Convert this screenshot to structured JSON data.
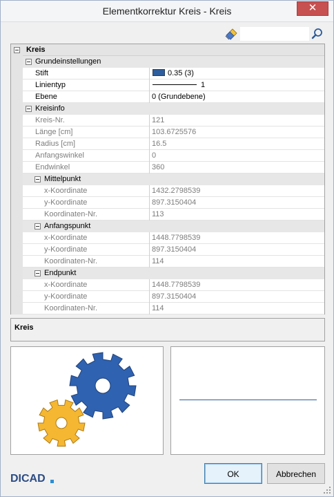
{
  "window": {
    "title": "Elementkorrektur Kreis - Kreis",
    "close_glyph": "✕"
  },
  "search": {
    "value": "",
    "placeholder": ""
  },
  "grid": {
    "rows": [
      {
        "kind": "section",
        "label": "Kreis"
      },
      {
        "kind": "cat",
        "label": "Grundeinstellungen"
      },
      {
        "kind": "prop",
        "label": "Stift",
        "value": "0.35 (3)",
        "swatch": "#2d5d9c"
      },
      {
        "kind": "prop",
        "label": "Linientyp",
        "value": "1"
      },
      {
        "kind": "prop",
        "label": "Ebene",
        "value": "0 (Grundebene)"
      },
      {
        "kind": "cat",
        "label": "Kreisinfo"
      },
      {
        "kind": "prop",
        "grey": true,
        "label": "Kreis-Nr.",
        "value": "121"
      },
      {
        "kind": "prop",
        "grey": true,
        "label": "Länge [cm]",
        "value": "103.6725576"
      },
      {
        "kind": "prop",
        "grey": true,
        "label": "Radius [cm]",
        "value": "16.5"
      },
      {
        "kind": "prop",
        "grey": true,
        "label": "Anfangswinkel",
        "value": "0"
      },
      {
        "kind": "prop",
        "grey": true,
        "label": "Endwinkel",
        "value": "360"
      },
      {
        "kind": "cat",
        "label": "Mittelpunkt"
      },
      {
        "kind": "prop",
        "grey": true,
        "label": "x-Koordinate",
        "value": "1432.2798539"
      },
      {
        "kind": "prop",
        "grey": true,
        "label": "y-Koordinate",
        "value": "897.3150404"
      },
      {
        "kind": "prop",
        "grey": true,
        "label": "Koordinaten-Nr.",
        "value": "113"
      },
      {
        "kind": "cat",
        "label": "Anfangspunkt"
      },
      {
        "kind": "prop",
        "grey": true,
        "label": "x-Koordinate",
        "value": "1448.7798539"
      },
      {
        "kind": "prop",
        "grey": true,
        "label": "y-Koordinate",
        "value": "897.3150404"
      },
      {
        "kind": "prop",
        "grey": true,
        "label": "Koordinaten-Nr.",
        "value": "114"
      },
      {
        "kind": "cat",
        "label": "Endpunkt"
      },
      {
        "kind": "prop",
        "grey": true,
        "label": "x-Koordinate",
        "value": "1448.7798539"
      },
      {
        "kind": "prop",
        "grey": true,
        "label": "y-Koordinate",
        "value": "897.3150404"
      },
      {
        "kind": "prop",
        "grey": true,
        "label": "Koordinaten-Nr.",
        "value": "114"
      }
    ]
  },
  "description": {
    "title": "Kreis"
  },
  "logo": {
    "text": "DICAD"
  },
  "buttons": {
    "ok": "OK",
    "cancel": "Abbrechen"
  },
  "icons": {
    "search": "search-icon",
    "brush": "brush-icon",
    "gears": "gears-icon",
    "close": "close-icon"
  },
  "colors": {
    "pen": "#2d5d9c",
    "gear_blue": "#2f62b0",
    "gear_yellow": "#f5b731",
    "close": "#c75050"
  }
}
